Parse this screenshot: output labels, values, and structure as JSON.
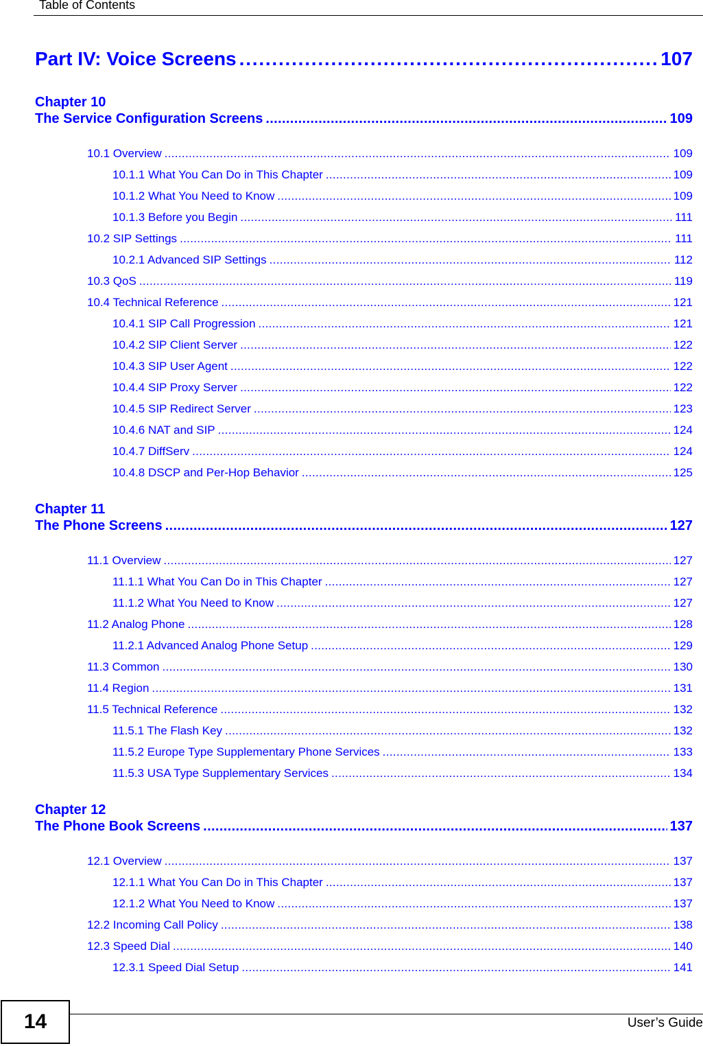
{
  "header": {
    "title": "Table of Contents"
  },
  "part": {
    "label": "Part IV: Voice Screens",
    "page": "107"
  },
  "chapters": [
    {
      "number": "Chapter  10",
      "title": "The Service Configuration Screens",
      "page": "109",
      "entries": [
        {
          "level": 1,
          "label": "10.1 Overview",
          "page": "109"
        },
        {
          "level": 2,
          "label": "10.1.1 What You Can Do in This Chapter",
          "page": "109"
        },
        {
          "level": 2,
          "label": "10.1.2 What You Need to Know",
          "page": "109"
        },
        {
          "level": 2,
          "label": "10.1.3 Before you Begin",
          "page": "111"
        },
        {
          "level": 1,
          "label": "10.2 SIP Settings",
          "page": "111"
        },
        {
          "level": 2,
          "label": "10.2.1 Advanced SIP Settings",
          "page": "112"
        },
        {
          "level": 1,
          "label": "10.3 QoS",
          "page": "119"
        },
        {
          "level": 1,
          "label": "10.4 Technical Reference",
          "page": "121"
        },
        {
          "level": 2,
          "label": "10.4.1 SIP Call Progression",
          "page": "121"
        },
        {
          "level": 2,
          "label": "10.4.2 SIP Client Server",
          "page": "122"
        },
        {
          "level": 2,
          "label": "10.4.3 SIP User Agent",
          "page": "122"
        },
        {
          "level": 2,
          "label": "10.4.4 SIP Proxy Server",
          "page": "122"
        },
        {
          "level": 2,
          "label": "10.4.5 SIP Redirect Server",
          "page": "123"
        },
        {
          "level": 2,
          "label": "10.4.6 NAT and SIP",
          "page": "124"
        },
        {
          "level": 2,
          "label": "10.4.7 DiffServ",
          "page": "124"
        },
        {
          "level": 2,
          "label": "10.4.8 DSCP and Per-Hop Behavior",
          "page": "125"
        }
      ]
    },
    {
      "number": "Chapter  11",
      "title": "The Phone Screens",
      "page": "127",
      "entries": [
        {
          "level": 1,
          "label": "11.1 Overview",
          "page": "127"
        },
        {
          "level": 2,
          "label": "11.1.1 What You Can Do in This Chapter",
          "page": "127"
        },
        {
          "level": 2,
          "label": "11.1.2 What You Need to Know",
          "page": "127"
        },
        {
          "level": 1,
          "label": "11.2 Analog Phone",
          "page": "128"
        },
        {
          "level": 2,
          "label": "11.2.1 Advanced Analog Phone Setup",
          "page": "129"
        },
        {
          "level": 1,
          "label": "11.3 Common",
          "page": "130"
        },
        {
          "level": 1,
          "label": "11.4 Region",
          "page": "131"
        },
        {
          "level": 1,
          "label": "11.5 Technical Reference",
          "page": "132"
        },
        {
          "level": 2,
          "label": "11.5.1 The Flash Key",
          "page": "132"
        },
        {
          "level": 2,
          "label": "11.5.2 Europe Type Supplementary Phone Services",
          "page": "133"
        },
        {
          "level": 2,
          "label": "11.5.3 USA Type Supplementary Services",
          "page": "134"
        }
      ]
    },
    {
      "number": "Chapter  12",
      "title": "The Phone Book Screens",
      "page": "137",
      "entries": [
        {
          "level": 1,
          "label": "12.1 Overview",
          "page": "137"
        },
        {
          "level": 2,
          "label": "12.1.1 What You Can Do in This Chapter",
          "page": "137"
        },
        {
          "level": 2,
          "label": "12.1.2 What You Need to Know",
          "page": "137"
        },
        {
          "level": 1,
          "label": "12.2 Incoming Call Policy",
          "page": "138"
        },
        {
          "level": 1,
          "label": "12.3 Speed Dial",
          "page": "140"
        },
        {
          "level": 2,
          "label": "12.3.1 Speed Dial Setup",
          "page": "141"
        }
      ]
    }
  ],
  "footer": {
    "page_number": "14",
    "guide_label": "User’s Guide"
  },
  "colors": {
    "link": "#0000ff",
    "text": "#000000"
  }
}
